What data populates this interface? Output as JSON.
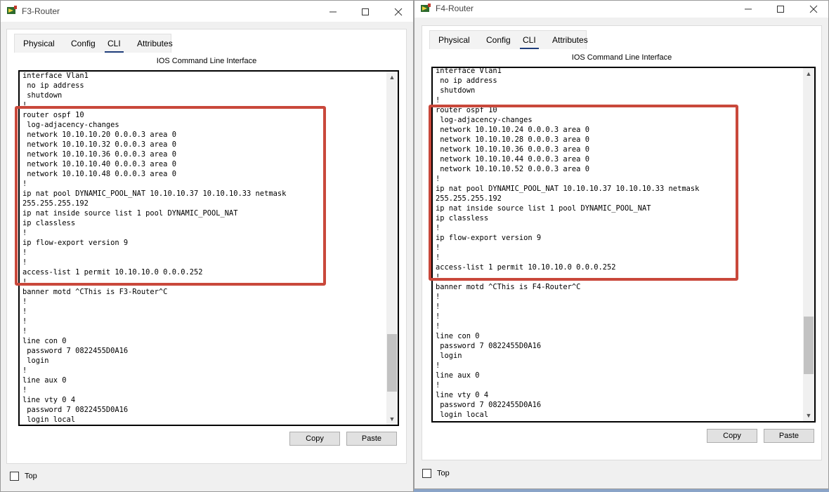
{
  "windows": [
    {
      "title": "F3-Router",
      "tabs": [
        "Physical",
        "Config",
        "CLI",
        "Attributes"
      ],
      "active_tab": "CLI",
      "panel_heading": "IOS Command Line Interface",
      "cli_text": "interface Vlan1\n no ip address\n shutdown\n!\nrouter ospf 10\n log-adjacency-changes\n network 10.10.10.20 0.0.0.3 area 0\n network 10.10.10.32 0.0.0.3 area 0\n network 10.10.10.36 0.0.0.3 area 0\n network 10.10.10.40 0.0.0.3 area 0\n network 10.10.10.48 0.0.0.3 area 0\n!\nip nat pool DYNAMIC_POOL_NAT 10.10.10.37 10.10.10.33 netmask\n255.255.255.192\nip nat inside source list 1 pool DYNAMIC_POOL_NAT\nip classless\n!\nip flow-export version 9\n!\n!\naccess-list 1 permit 10.10.10.0 0.0.0.252\n!\nbanner motd ^CThis is F3-Router^C\n!\n!\n!\n!\nline con 0\n password 7 0822455D0A16\n login\n!\nline aux 0\n!\nline vty 0 4\n password 7 0822455D0A16\n login local",
      "copy_label": "Copy",
      "paste_label": "Paste",
      "top_label": "Top"
    },
    {
      "title": "F4-Router",
      "tabs": [
        "Physical",
        "Config",
        "CLI",
        "Attributes"
      ],
      "active_tab": "CLI",
      "panel_heading": "IOS Command Line Interface",
      "cli_text": "interface Vlan1\n no ip address\n shutdown\n!\nrouter ospf 10\n log-adjacency-changes\n network 10.10.10.24 0.0.0.3 area 0\n network 10.10.10.28 0.0.0.3 area 0\n network 10.10.10.36 0.0.0.3 area 0\n network 10.10.10.44 0.0.0.3 area 0\n network 10.10.10.52 0.0.0.3 area 0\n!\nip nat pool DYNAMIC_POOL_NAT 10.10.10.37 10.10.10.33 netmask\n255.255.255.192\nip nat inside source list 1 pool DYNAMIC_POOL_NAT\nip classless\n!\nip flow-export version 9\n!\n!\naccess-list 1 permit 10.10.10.0 0.0.0.252\n!\nbanner motd ^CThis is F4-Router^C\n!\n!\n!\n!\nline con 0\n password 7 0822455D0A16\n login\n!\nline aux 0\n!\nline vty 0 4\n password 7 0822455D0A16\n login local",
      "copy_label": "Copy",
      "paste_label": "Paste",
      "top_label": "Top"
    }
  ],
  "highlight_color": "#c9483b",
  "tab_underline_color": "#1f3d7a",
  "icons": [
    "packet-tracer-router-icon",
    "minimize-icon",
    "maximize-icon",
    "close-icon",
    "scroll-up-icon",
    "scroll-down-icon"
  ]
}
